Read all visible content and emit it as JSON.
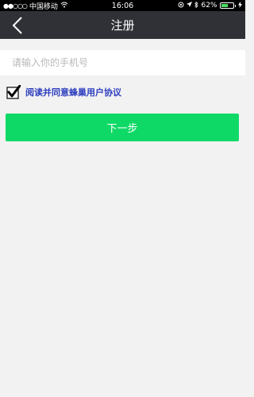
{
  "status_bar": {
    "carrier": "中国移动",
    "time": "16:06",
    "battery_percent": "62%",
    "battery_level": 0.62,
    "signal_icon": "signal-dots-icon",
    "wifi_icon": "wifi-icon"
  },
  "nav": {
    "title": "注册",
    "back_icon": "chevron-left-icon"
  },
  "form": {
    "phone_placeholder": "请输入你的手机号",
    "phone_value": "",
    "agreement_checked": true,
    "agreement_text": "阅读并同意蜂巢用户协议",
    "next_label": "下一步"
  },
  "colors": {
    "nav_bg": "#2f3136",
    "button_bg": "#0fd966",
    "link": "#2e3fbf",
    "page_bg": "#f2f2f2"
  }
}
